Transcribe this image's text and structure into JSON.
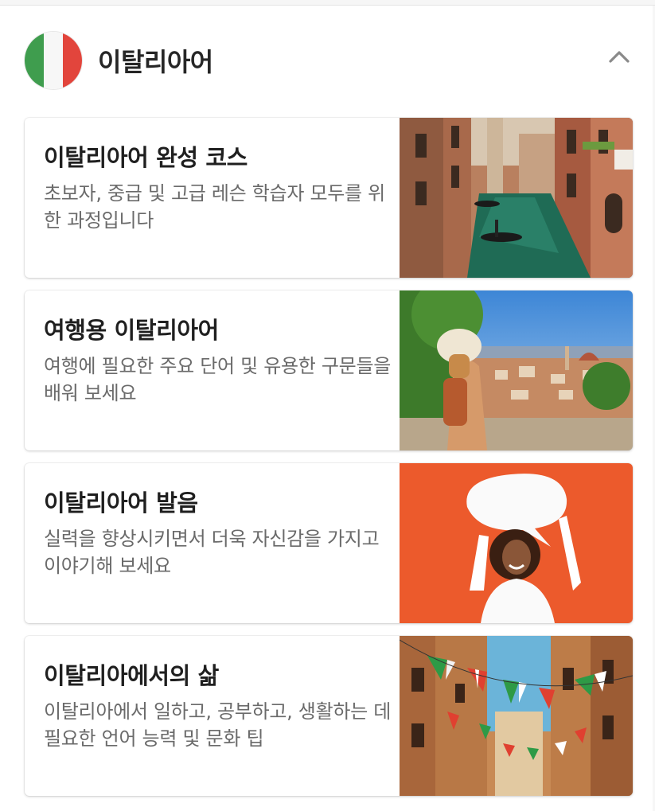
{
  "language": {
    "title": "이탈리아어",
    "flag_icon": "italy-flag-icon",
    "collapse_icon": "chevron-up-icon"
  },
  "courses": [
    {
      "title": "이탈리아어 완성 코스",
      "description": "초보자, 중급 및 고급 레슨 학습자 모두를 위한 과정입니다",
      "image": "venice-canal-gondola-photo"
    },
    {
      "title": "여행용 이탈리아어",
      "description": "여행에 필요한 주요 단어 및 유용한 구문들을 배워 보세요",
      "image": "traveler-florence-view-photo"
    },
    {
      "title": "이탈리아어 발음",
      "description": "실력을 향상시키면서 더욱 자신감을 가지고 이야기해 보세요",
      "image": "woman-speech-bubble-photo"
    },
    {
      "title": "이탈리아에서의 삶",
      "description": "이탈리아에서 일하고, 공부하고, 생활하는 데 필요한 언어 능력 및 문화 팁",
      "image": "italian-street-flags-photo"
    }
  ],
  "colors": {
    "accent_orange": "#ec5a2c",
    "flag_green": "#3f9d4e",
    "flag_red": "#e2453c"
  }
}
